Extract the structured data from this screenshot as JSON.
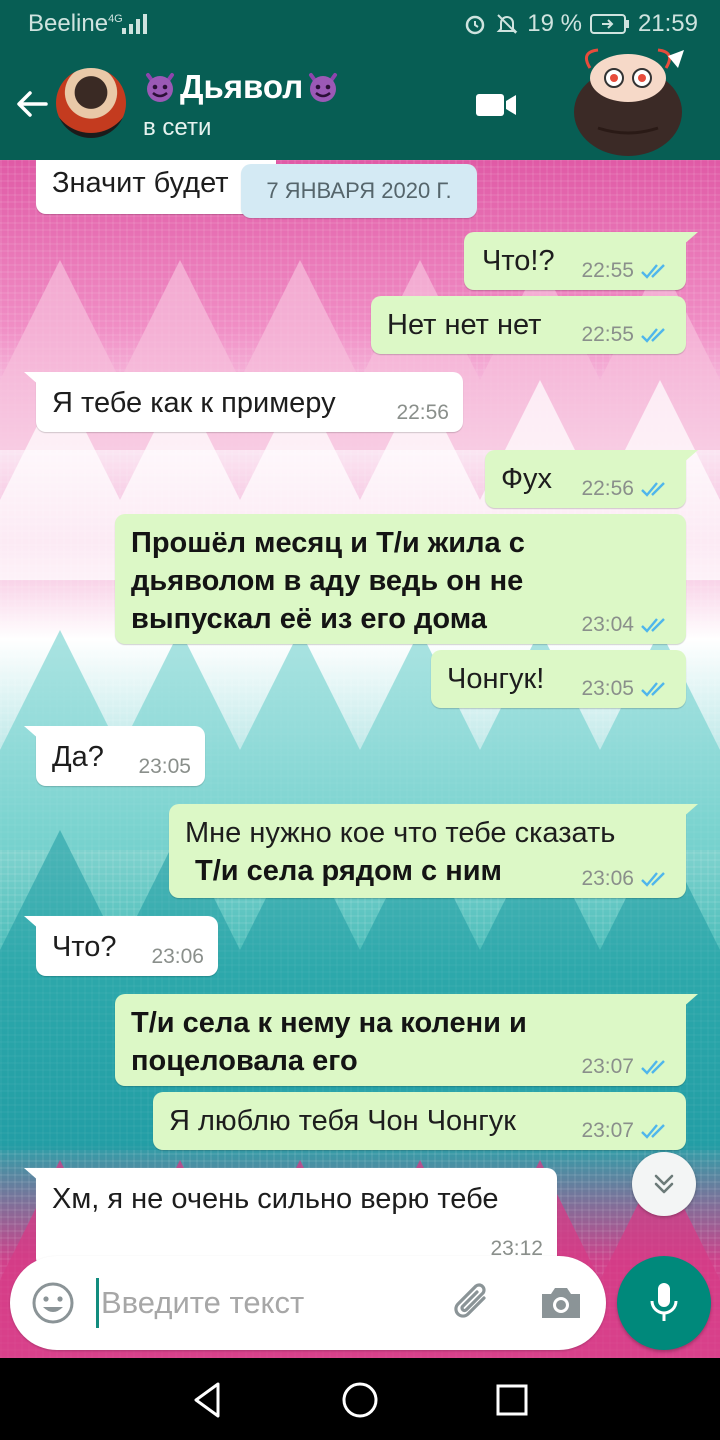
{
  "status_bar": {
    "carrier": "Beeline",
    "network": "4G",
    "battery": "19 %",
    "time": "21:59"
  },
  "header": {
    "contact_name": "Дьявол",
    "status": "в сети"
  },
  "chat": {
    "date_chip": "7 ЯНВАРЯ 2020 Г.",
    "messages": [
      {
        "dir": "in",
        "text": "Значит будет",
        "time": "",
        "bold": false
      },
      {
        "dir": "out",
        "text": "Что!?",
        "time": "22:55",
        "bold": false
      },
      {
        "dir": "out",
        "text": "Нет нет нет",
        "time": "22:55",
        "bold": false
      },
      {
        "dir": "in",
        "text": "Я тебе как к примеру",
        "time": "22:56",
        "bold": false
      },
      {
        "dir": "out",
        "text": "Фух",
        "time": "22:56",
        "bold": false
      },
      {
        "dir": "out",
        "lines": [
          "Прошёл месяц и Т/и жила с",
          "дьяволом в аду ведь он не",
          "выпускал её из его дома"
        ],
        "time": "23:04",
        "bold": true
      },
      {
        "dir": "out",
        "text": "Чонгук!",
        "time": "23:05",
        "bold": false
      },
      {
        "dir": "in",
        "text": "Да?",
        "time": "23:05",
        "bold": false
      },
      {
        "dir": "out",
        "lines": [
          "Мне нужно кое что тебе сказать",
          "Т/и села рядом с ним"
        ],
        "time": "23:06",
        "bold": false
      },
      {
        "dir": "in",
        "text": "Что?",
        "time": "23:06",
        "bold": false
      },
      {
        "dir": "out",
        "lines": [
          "Т/и села к нему на колени и",
          "поцеловала его"
        ],
        "time": "23:07",
        "bold": true
      },
      {
        "dir": "out",
        "text": "Я люблю тебя Чон Чонгук",
        "time": "23:07",
        "bold": false
      },
      {
        "dir": "in",
        "text": "Хм, я не очень сильно верю тебе",
        "time": "23:12",
        "bold": false
      }
    ]
  },
  "input": {
    "placeholder": "Введите текст"
  },
  "colors": {
    "header": "#075e54",
    "outgoing_bubble": "#dcf8c6",
    "incoming_bubble": "#ffffff",
    "mic_button": "#00897b",
    "read_ticks": "#4fb6ec"
  },
  "icons": [
    "back-arrow-icon",
    "video-call-icon",
    "emoji-icon",
    "attach-icon",
    "camera-icon",
    "mic-icon",
    "scroll-down-icon",
    "double-check-icon"
  ]
}
